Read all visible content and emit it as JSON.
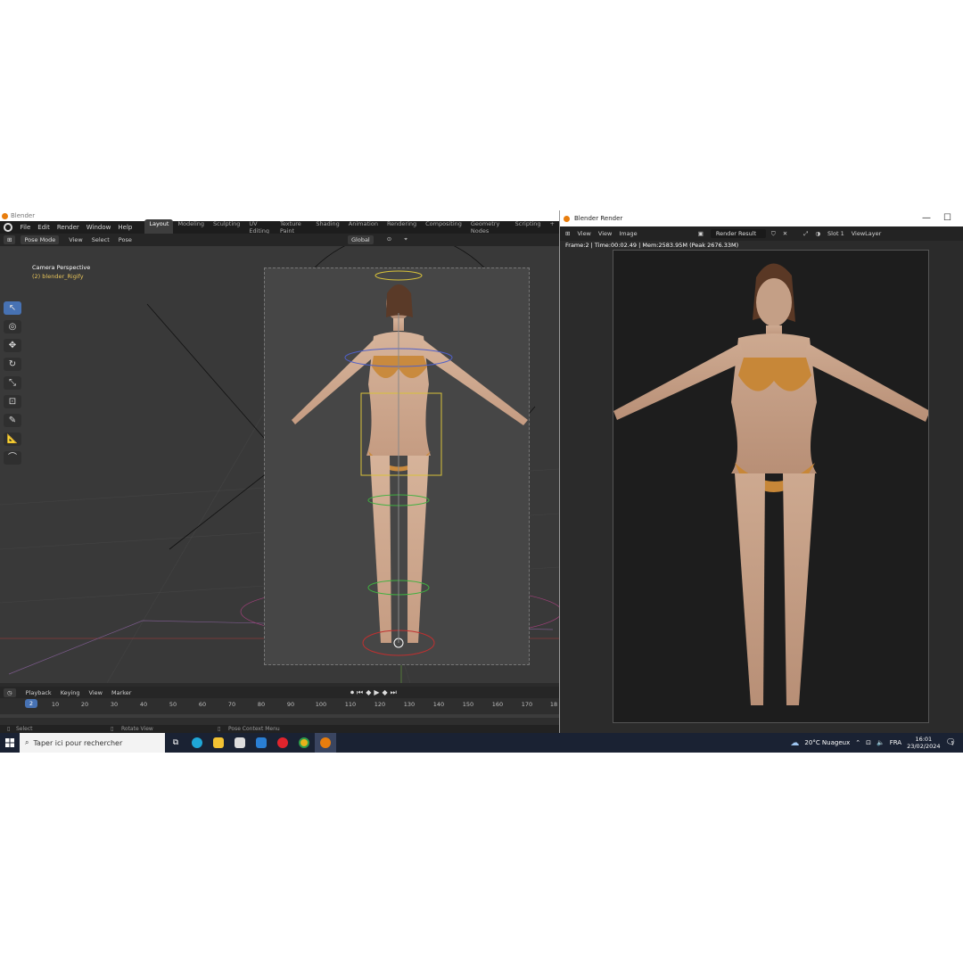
{
  "blender": {
    "title": "Blender",
    "menus": [
      "File",
      "Edit",
      "Render",
      "Window",
      "Help"
    ],
    "workspaces": [
      "Layout",
      "Modeling",
      "Sculpting",
      "UV Editing",
      "Texture Paint",
      "Shading",
      "Animation",
      "Rendering",
      "Compositing",
      "Geometry Nodes",
      "Scripting"
    ],
    "active_workspace": "Layout",
    "header": {
      "mode": "Pose Mode",
      "view": "View",
      "select": "Select",
      "pose": "Pose",
      "orientation": "Global"
    },
    "viewport": {
      "camera_label": "Camera Perspective",
      "object_label": "(2) blender_Rigify"
    },
    "timeline": {
      "playback": "Playback",
      "keying": "Keying",
      "view": "View",
      "marker": "Marker",
      "current_frame": "2",
      "ticks": [
        "10",
        "20",
        "30",
        "40",
        "50",
        "60",
        "70",
        "80",
        "90",
        "100",
        "110",
        "120",
        "130",
        "140",
        "150",
        "160",
        "170",
        "18"
      ]
    },
    "statusbar": {
      "select": "Select",
      "rotate": "Rotate View",
      "context": "Pose Context Menu"
    }
  },
  "render_window": {
    "title": "Blender Render",
    "menus": [
      "View",
      "View",
      "Image"
    ],
    "result": "Render Result",
    "slot": "Slot 1",
    "view_layer": "ViewLayer",
    "info": "Frame:2 | Time:00:02.49 | Mem:2583.95M (Peak 2676.33M)"
  },
  "taskbar": {
    "search_placeholder": "Taper ici pour rechercher",
    "weather": "20°C  Nuageux",
    "language": "FRA",
    "time": "16:01",
    "date": "23/02/2024",
    "notification_count": "5"
  }
}
